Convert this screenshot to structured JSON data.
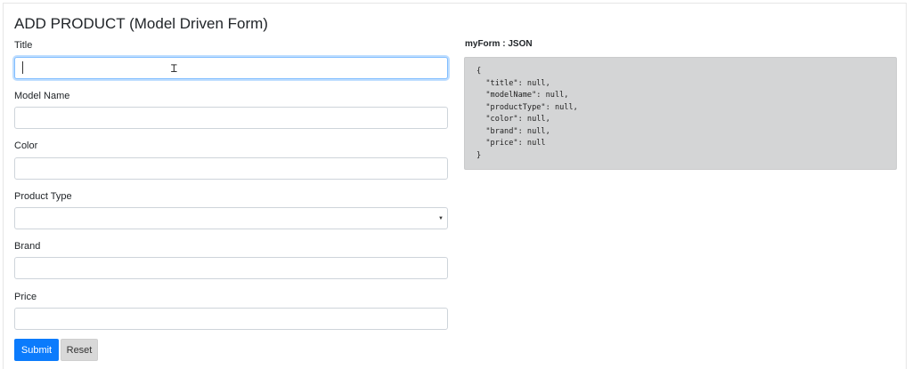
{
  "page": {
    "title": "ADD PRODUCT (Model Driven Form)"
  },
  "form": {
    "fields": [
      {
        "label": "Title",
        "value": "",
        "type": "text"
      },
      {
        "label": "Model Name",
        "value": "",
        "type": "text"
      },
      {
        "label": "Color",
        "value": "",
        "type": "text"
      },
      {
        "label": "Product Type",
        "value": "",
        "type": "select"
      },
      {
        "label": "Brand",
        "value": "",
        "type": "text"
      },
      {
        "label": "Price",
        "value": "",
        "type": "text"
      }
    ],
    "submit_label": "Submit",
    "reset_label": "Reset"
  },
  "json_preview": {
    "heading": "myForm : JSON",
    "content": "{\n  \"title\": null,\n  \"modelName\": null,\n  \"productType\": null,\n  \"color\": null,\n  \"brand\": null,\n  \"price\": null\n}"
  },
  "icons": {
    "select_arrow": "chevron-down-icon",
    "cursor": "text-cursor-icon"
  },
  "colors": {
    "primary": "#0b7bfc",
    "focus_border": "#80bdff",
    "json_bg": "#d4d5d6",
    "reset_bg": "#d8d8d8"
  }
}
